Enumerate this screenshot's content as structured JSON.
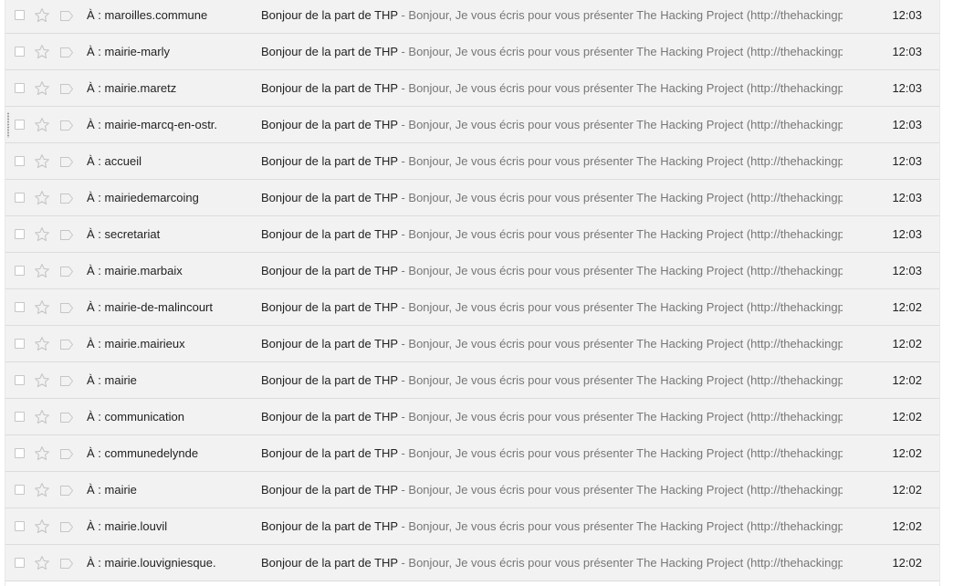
{
  "messages": [
    {
      "recipient": "À : maroilles.commune",
      "subject": "Bonjour de la part de THP",
      "snippet": " - Bonjour, Je vous écris pour vous présenter The Hacking Project (http://thehackingproject.org/)",
      "time": "12:03"
    },
    {
      "recipient": "À : mairie-marly",
      "subject": "Bonjour de la part de THP",
      "snippet": " - Bonjour, Je vous écris pour vous présenter The Hacking Project (http://thehackingproject.org/)",
      "time": "12:03"
    },
    {
      "recipient": "À : mairie.maretz",
      "subject": "Bonjour de la part de THP",
      "snippet": " - Bonjour, Je vous écris pour vous présenter The Hacking Project (http://thehackingproject.org/)",
      "time": "12:03"
    },
    {
      "recipient": "À : mairie-marcq-en-ostr.",
      "subject": "Bonjour de la part de THP",
      "snippet": " - Bonjour, Je vous écris pour vous présenter The Hacking Project (http://thehackingproject.org/)",
      "time": "12:03"
    },
    {
      "recipient": "À : accueil",
      "subject": "Bonjour de la part de THP",
      "snippet": " - Bonjour, Je vous écris pour vous présenter The Hacking Project (http://thehackingproject.org/)",
      "time": "12:03"
    },
    {
      "recipient": "À : mairiedemarcoing",
      "subject": "Bonjour de la part de THP",
      "snippet": " - Bonjour, Je vous écris pour vous présenter The Hacking Project (http://thehackingproject.org/)",
      "time": "12:03"
    },
    {
      "recipient": "À : secretariat",
      "subject": "Bonjour de la part de THP",
      "snippet": " - Bonjour, Je vous écris pour vous présenter The Hacking Project (http://thehackingproject.org/)",
      "time": "12:03"
    },
    {
      "recipient": "À : mairie.marbaix",
      "subject": "Bonjour de la part de THP",
      "snippet": " - Bonjour, Je vous écris pour vous présenter The Hacking Project (http://thehackingproject.org/)",
      "time": "12:03"
    },
    {
      "recipient": "À : mairie-de-malincourt",
      "subject": "Bonjour de la part de THP",
      "snippet": " - Bonjour, Je vous écris pour vous présenter The Hacking Project (http://thehackingproject.org/)",
      "time": "12:02"
    },
    {
      "recipient": "À : mairie.mairieux",
      "subject": "Bonjour de la part de THP",
      "snippet": " - Bonjour, Je vous écris pour vous présenter The Hacking Project (http://thehackingproject.org/)",
      "time": "12:02"
    },
    {
      "recipient": "À : mairie",
      "subject": "Bonjour de la part de THP",
      "snippet": " - Bonjour, Je vous écris pour vous présenter The Hacking Project (http://thehackingproject.org/)",
      "time": "12:02"
    },
    {
      "recipient": "À : communication",
      "subject": "Bonjour de la part de THP",
      "snippet": " - Bonjour, Je vous écris pour vous présenter The Hacking Project (http://thehackingproject.org/)",
      "time": "12:02"
    },
    {
      "recipient": "À : communedelynde",
      "subject": "Bonjour de la part de THP",
      "snippet": " - Bonjour, Je vous écris pour vous présenter The Hacking Project (http://thehackingproject.org/)",
      "time": "12:02"
    },
    {
      "recipient": "À : mairie",
      "subject": "Bonjour de la part de THP",
      "snippet": " - Bonjour, Je vous écris pour vous présenter The Hacking Project (http://thehackingproject.org/)",
      "time": "12:02"
    },
    {
      "recipient": "À : mairie.louvil",
      "subject": "Bonjour de la part de THP",
      "snippet": " - Bonjour, Je vous écris pour vous présenter The Hacking Project (http://thehackingproject.org/)",
      "time": "12:02"
    },
    {
      "recipient": "À : mairie.louvigniesque.",
      "subject": "Bonjour de la part de THP",
      "snippet": " - Bonjour, Je vous écris pour vous présenter The Hacking Project (http://thehackingproject.org/)",
      "time": "12:02"
    }
  ],
  "icons": {
    "checkbox": "checkbox-icon",
    "star": "star-icon",
    "label": "label-tag-icon",
    "drag": "drag-handle-icon"
  },
  "colors": {
    "row_background": "#f2f2f2",
    "snippet_text": "#777777",
    "icon_gray": "#c6c6c6"
  }
}
